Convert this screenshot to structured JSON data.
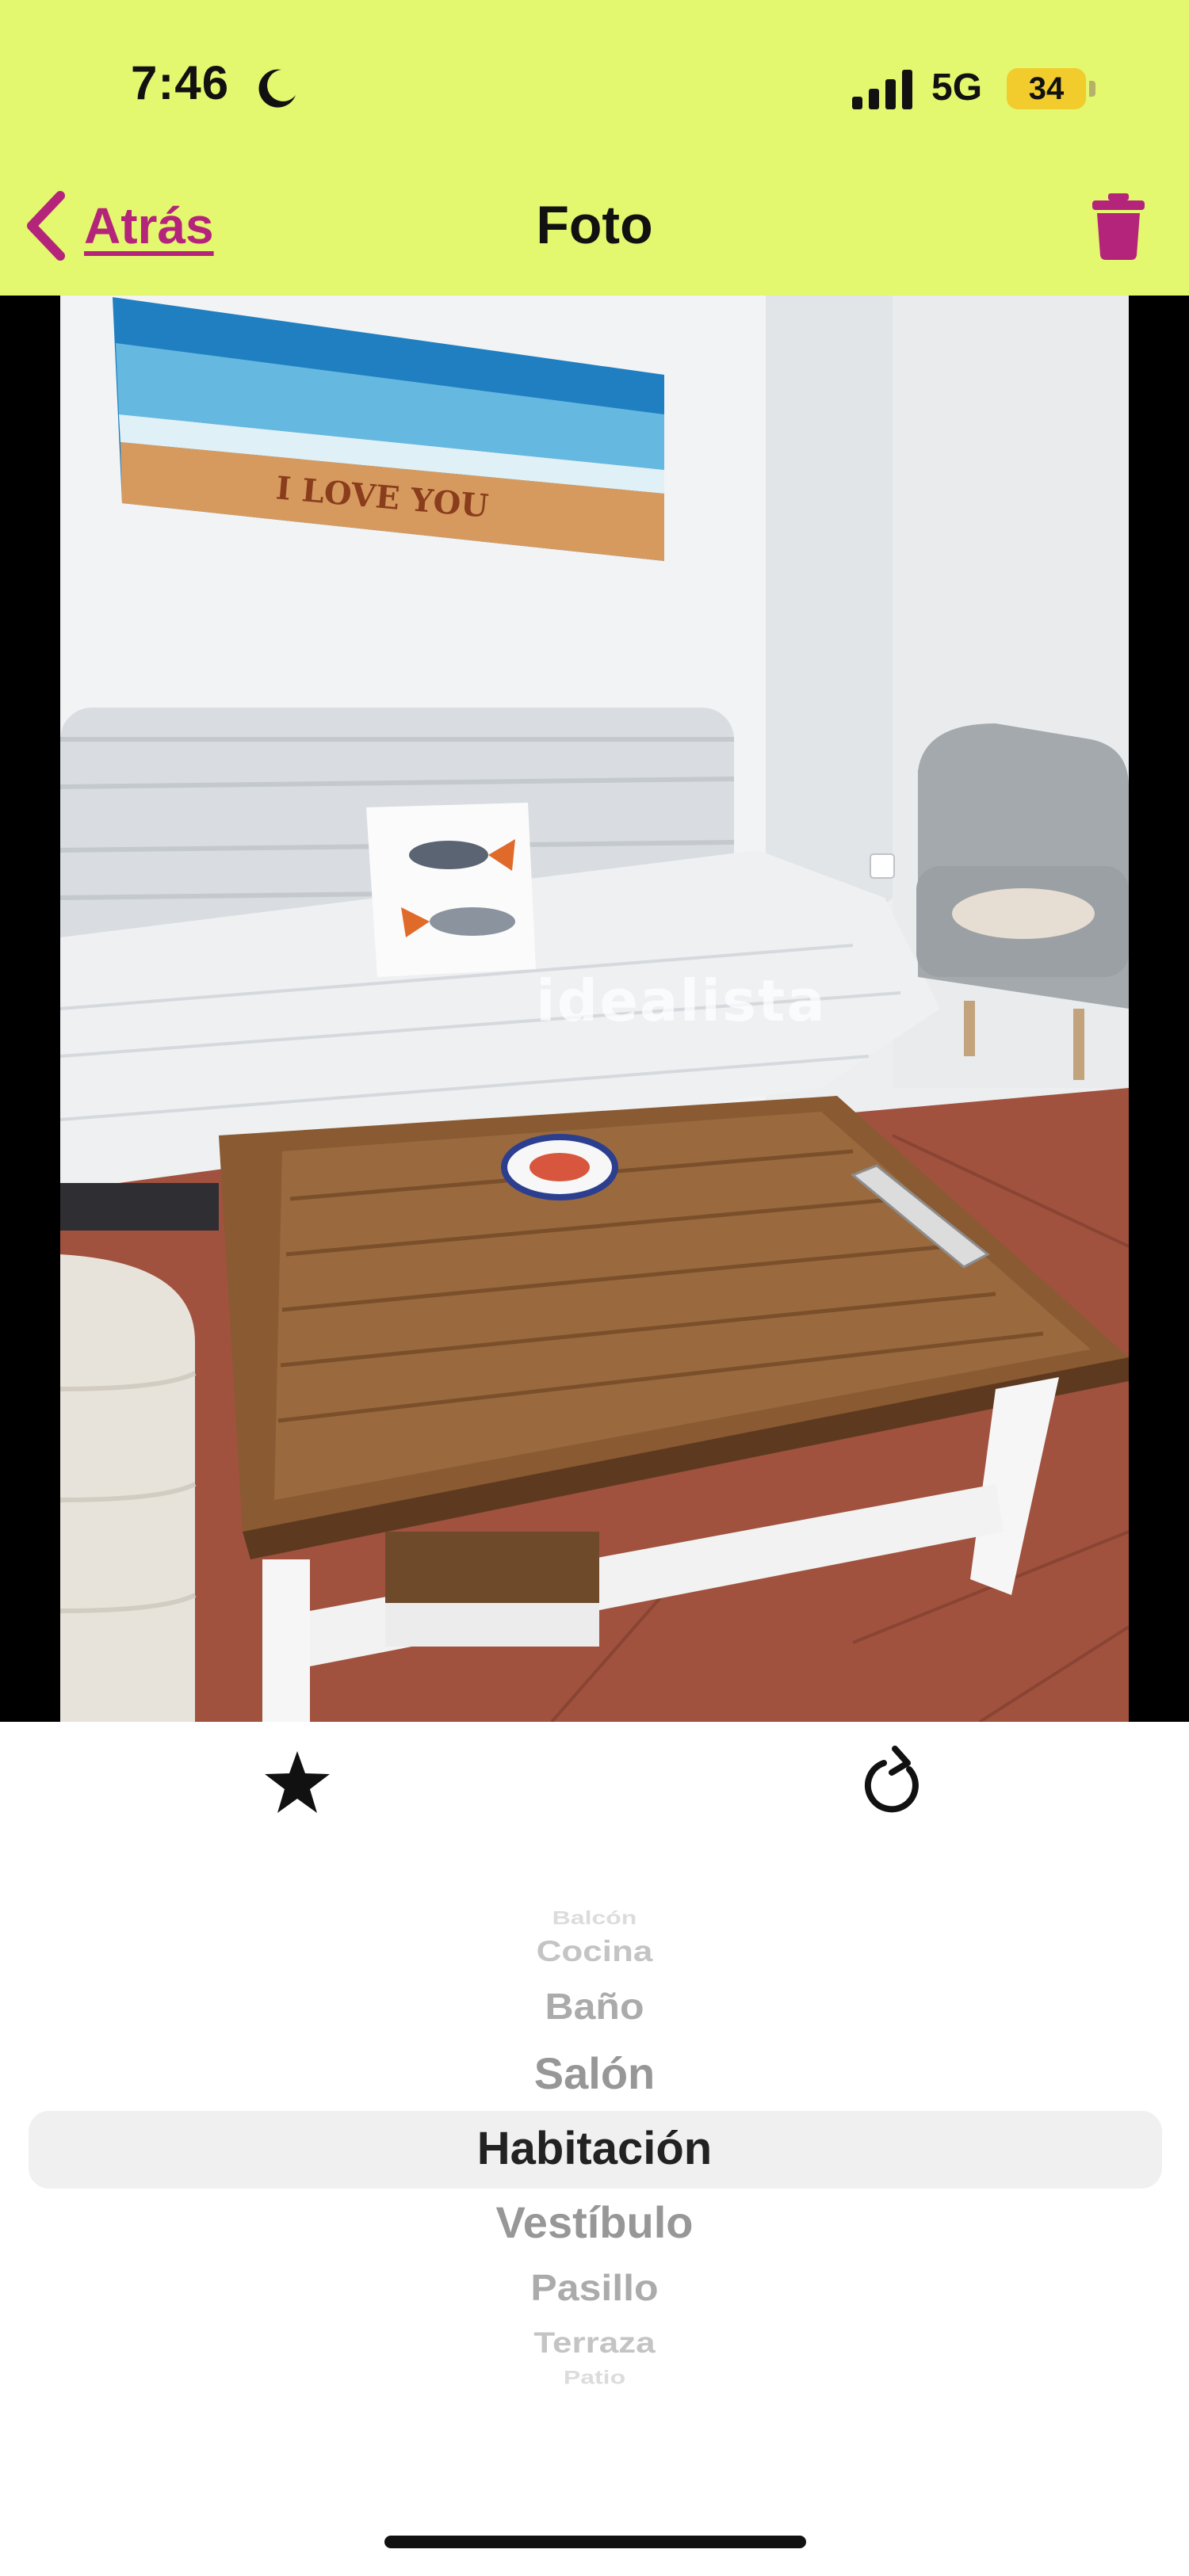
{
  "status_bar": {
    "time": "7:46",
    "network": "5G",
    "battery": "34"
  },
  "nav": {
    "back_label": "Atrás",
    "title": "Foto",
    "accent_color": "#b4247a",
    "header_color": "#e3f76f"
  },
  "photo": {
    "watermark": "idealista",
    "painting_text": "I LOVE YOU"
  },
  "actions": {
    "favorite_icon": "star-icon",
    "rotate_icon": "rotate-icon"
  },
  "room_picker": {
    "options": [
      "Balcón",
      "Cocina",
      "Baño",
      "Salón",
      "Habitación",
      "Vestíbulo",
      "Pasillo",
      "Terraza",
      "Patio"
    ],
    "selected": "Habitación"
  }
}
